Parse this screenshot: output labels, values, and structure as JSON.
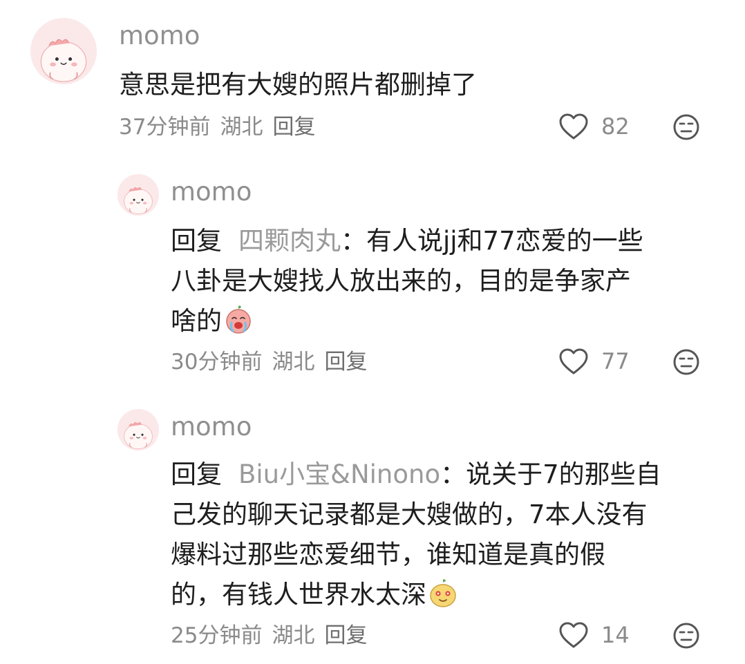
{
  "comments": [
    {
      "username": "momo",
      "text_lines": [
        "意思是把有大嫂的照片都删掉了"
      ],
      "time": "37分钟前",
      "location": "湖北",
      "reply_label": "回复",
      "likes": "82"
    },
    {
      "username": "momo",
      "reply_prefix": "回复",
      "reply_target": "四颗肉丸",
      "text_lines": [
        "：有人说jj和77恋爱的一些",
        "八卦是大嫂找人放出来的，目的是争家产",
        "啥的"
      ],
      "emoji": "laugh-cry-emoji",
      "time": "30分钟前",
      "location": "湖北",
      "reply_label": "回复",
      "likes": "77"
    },
    {
      "username": "momo",
      "reply_prefix": "回复",
      "reply_target": "Biu小宝&Ninono",
      "text_lines": [
        "：说关于7的那些自",
        "己发的聊天记录都是大嫂做的，7本人没有",
        "爆料过那些恋爱细节，谁知道是真的假",
        "的，有钱人世界水太深"
      ],
      "emoji": "smirk-emoji",
      "time": "25分钟前",
      "location": "湖北",
      "reply_label": "回复",
      "likes": "14"
    }
  ],
  "colors": {
    "username": "#8f8f8f",
    "text": "#1e1e1e",
    "reply_target": "#9a9a9a",
    "meta": "#8a8a8a",
    "avatar_bg": "#fbe9ea"
  }
}
